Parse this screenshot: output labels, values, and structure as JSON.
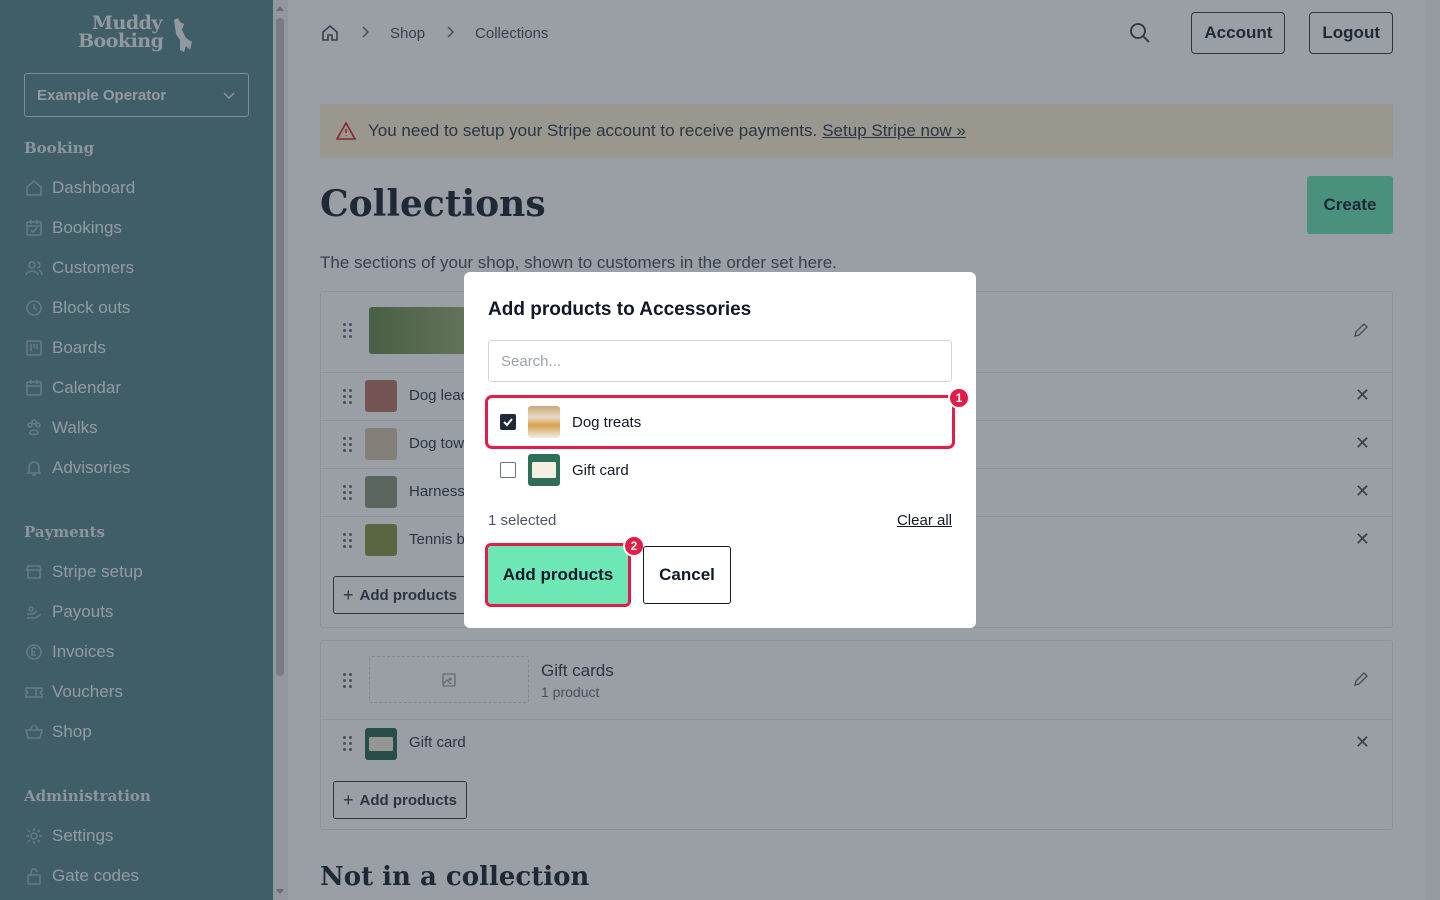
{
  "app": {
    "logo_text_1": "Muddy",
    "logo_text_2": "Booking",
    "operator_select": "Example Operator"
  },
  "sidebar": {
    "sections": [
      {
        "title": "Booking",
        "items": [
          {
            "label": "Dashboard",
            "icon": "home-icon"
          },
          {
            "label": "Bookings",
            "icon": "calendar-check-icon"
          },
          {
            "label": "Customers",
            "icon": "users-icon"
          },
          {
            "label": "Block outs",
            "icon": "clock-icon"
          },
          {
            "label": "Boards",
            "icon": "board-icon"
          },
          {
            "label": "Calendar",
            "icon": "calendar-icon"
          },
          {
            "label": "Walks",
            "icon": "paw-icon"
          },
          {
            "label": "Advisories",
            "icon": "bell-icon"
          }
        ]
      },
      {
        "title": "Payments",
        "items": [
          {
            "label": "Stripe setup",
            "icon": "store-icon"
          },
          {
            "label": "Payouts",
            "icon": "payout-icon"
          },
          {
            "label": "Invoices",
            "icon": "pound-icon"
          },
          {
            "label": "Vouchers",
            "icon": "ticket-icon"
          },
          {
            "label": "Shop",
            "icon": "basket-icon"
          }
        ]
      },
      {
        "title": "Administration",
        "items": [
          {
            "label": "Settings",
            "icon": "gear-icon"
          },
          {
            "label": "Gate codes",
            "icon": "lock-icon"
          }
        ]
      }
    ]
  },
  "header": {
    "breadcrumb": [
      "Shop",
      "Collections"
    ],
    "account_label": "Account",
    "logout_label": "Logout"
  },
  "alert": {
    "message": "You need to setup your Stripe account to receive payments.",
    "link": "Setup Stripe now »"
  },
  "page": {
    "title": "Collections",
    "create_label": "Create",
    "subtitle": "The sections of your shop, shown to customers in the order set here.",
    "not_in_collection_title": "Not in a collection"
  },
  "collections": [
    {
      "name": "Accessories",
      "products": [
        "Dog lead",
        "Dog towel",
        "Harness",
        "Tennis ball"
      ],
      "add_label": "Add products"
    },
    {
      "name": "Gift cards",
      "count_text": "1 product",
      "products": [
        "Gift card"
      ],
      "add_label": "Add products"
    }
  ],
  "modal": {
    "title": "Add products to Accessories",
    "search_placeholder": "Search...",
    "options": [
      {
        "label": "Dog treats",
        "checked": true
      },
      {
        "label": "Gift card",
        "checked": false
      }
    ],
    "selected_count": "1 selected",
    "clear_all": "Clear all",
    "confirm_label": "Add products",
    "cancel_label": "Cancel",
    "step_badges": [
      "1",
      "2"
    ]
  },
  "colors": {
    "sidebar": "#5b8a8f",
    "primary": "#6ee7b7",
    "highlight": "#e11d48",
    "alert_bg": "#fdf3d6"
  }
}
